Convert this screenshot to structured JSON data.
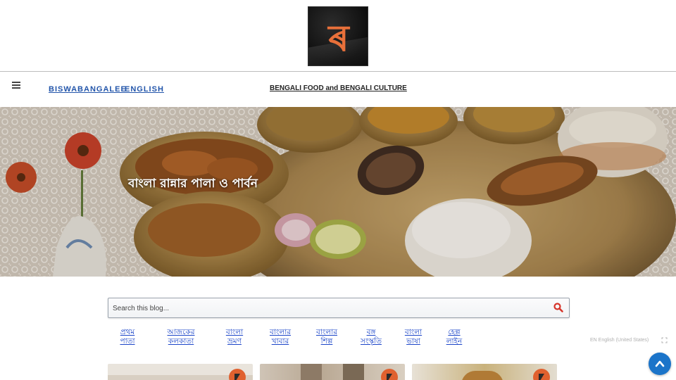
{
  "header": {
    "logo_glyph": "ৰ",
    "logo_color": "#e8703a"
  },
  "nav": {
    "menu_icon": "hamburger-menu-icon",
    "links": [
      "BISWABANGALEE",
      "ENGLISH"
    ],
    "tagline": "BENGALI FOOD and BENGALI CULTURE"
  },
  "hero": {
    "title": "বাংলা রান্নার পালা ও পার্বন"
  },
  "search": {
    "placeholder": "Search this blog...",
    "icon": "search-icon",
    "icon_color": "#d6342a"
  },
  "categories": [
    {
      "line1": "প্রথম",
      "line2": "পাতা"
    },
    {
      "line1": "আজকের",
      "line2": "কলকাতা"
    },
    {
      "line1": "বাংলা",
      "line2": "ভ্রমণ"
    },
    {
      "line1": "বাংলার",
      "line2": "খাবার"
    },
    {
      "line1": "বাংলার",
      "line2": "শিল্প"
    },
    {
      "line1": "বঙ্গ",
      "line2": "সংস্কৃতি"
    },
    {
      "line1": "বাংলা",
      "line2": "ভাষা"
    },
    {
      "line1": "হেল্প",
      "line2": "লাইন"
    }
  ],
  "language": {
    "label": "EN English (United States)",
    "expand_icon": "expand-icon"
  },
  "scroll_top": {
    "icon": "chevron-up-icon",
    "color": "#1b74c9"
  },
  "cards": [
    {
      "badge_icon": "logo-badge-icon"
    },
    {
      "badge_icon": "logo-badge-icon"
    },
    {
      "badge_icon": "logo-badge-icon"
    }
  ]
}
